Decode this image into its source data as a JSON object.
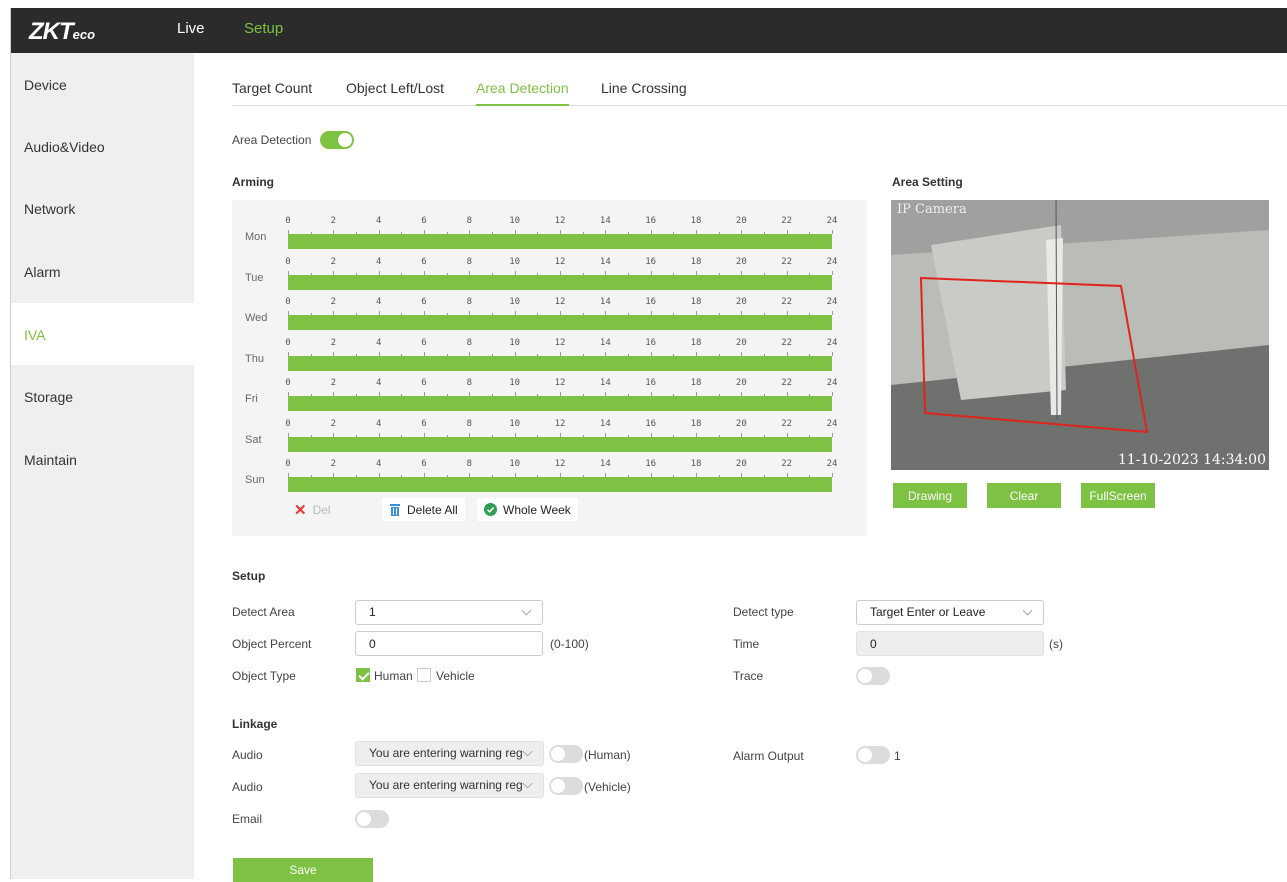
{
  "colors": {
    "accent": "#7dc242",
    "topbar": "#2b2b2b",
    "sidebar": "#efefef"
  },
  "header": {
    "logo_main": "ZKT",
    "logo_suffix": "eco",
    "nav": [
      {
        "label": "Live"
      },
      {
        "label": "Setup",
        "active": true
      }
    ]
  },
  "sidebar": {
    "items": [
      {
        "label": "Device"
      },
      {
        "label": "Audio&Video"
      },
      {
        "label": "Network"
      },
      {
        "label": "Alarm"
      },
      {
        "label": "IVA",
        "active": true
      },
      {
        "label": "Storage"
      },
      {
        "label": "Maintain"
      }
    ]
  },
  "tabs": [
    {
      "label": "Target Count"
    },
    {
      "label": "Object Left/Lost"
    },
    {
      "label": "Area Detection",
      "active": true
    },
    {
      "label": "Line Crossing"
    }
  ],
  "area_detection": {
    "label": "Area Detection",
    "enabled": true
  },
  "arming": {
    "title": "Arming",
    "hours": [
      "0",
      "2",
      "4",
      "6",
      "8",
      "10",
      "12",
      "14",
      "16",
      "18",
      "20",
      "22",
      "24"
    ],
    "days": [
      "Mon",
      "Tue",
      "Wed",
      "Thu",
      "Fri",
      "Sat",
      "Sun"
    ],
    "schedule_fraction": 1.0,
    "del_label": "Del",
    "delete_all_label": "Delete All",
    "whole_week_label": "Whole Week"
  },
  "area_setting": {
    "title": "Area Setting",
    "camera_title": "IP Camera",
    "camera_time": "11-10-2023 14:34:00",
    "drawing_label": "Drawing",
    "clear_label": "Clear",
    "fullscreen_label": "FullScreen"
  },
  "setup": {
    "title": "Setup",
    "detect_area_label": "Detect Area",
    "detect_area_value": "1",
    "object_percent_label": "Object Percent",
    "object_percent_value": "0",
    "object_percent_range": "(0-100)",
    "object_type_label": "Object Type",
    "human_label": "Human",
    "human_checked": true,
    "vehicle_label": "Vehicle",
    "vehicle_checked": false,
    "detect_type_label": "Detect type",
    "detect_type_value": "Target Enter or Leave",
    "time_label": "Time",
    "time_value": "0",
    "time_unit": "(s)",
    "trace_label": "Trace",
    "trace_enabled": false
  },
  "linkage": {
    "title": "Linkage",
    "audio1_label": "Audio",
    "audio1_value": "You are entering warning reg",
    "audio1_suffix": "(Human)",
    "audio2_label": "Audio",
    "audio2_value": "You are entering warning reg",
    "audio2_suffix": "(Vehicle)",
    "email_label": "Email",
    "alarm_output_label": "Alarm Output",
    "alarm_output_value": "1"
  },
  "save_label": "Save"
}
